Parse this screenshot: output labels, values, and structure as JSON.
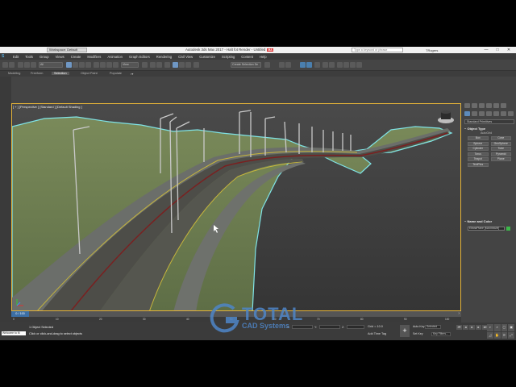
{
  "titlebar": {
    "workspace": "Workspace: Default",
    "title": "Autodesk 3ds Max 2017 - Halt fot Render - Untitled",
    "badge": "MA",
    "search_placeholder": "Type a keyword or phrase",
    "user": "TRogers",
    "win_min": "—",
    "win_max": "□",
    "win_close": "✕"
  },
  "menubar": {
    "logo": "S",
    "items": [
      "Edit",
      "Tools",
      "Group",
      "Views",
      "Create",
      "Modifiers",
      "Animation",
      "Graph Editors",
      "Rendering",
      "Civil View",
      "Customize",
      "Scripting",
      "Content",
      "Help"
    ]
  },
  "toolbar": {
    "selection_set": "Create Selection Se"
  },
  "ribbon": {
    "tabs": [
      "Modeling",
      "Freeform",
      "Selection",
      "Object Paint",
      "Populate"
    ]
  },
  "viewport": {
    "label": "[ + ] [Perspective ] [Standard ] [Default Shading ]"
  },
  "command_panel": {
    "dropdown": "Standard Primitives",
    "object_type_header": "Object Type",
    "autogrid": "AutoGrid",
    "primitives": [
      "Box",
      "Cone",
      "Sphere",
      "GeoSphere",
      "Cylinder",
      "Tube",
      "Torus",
      "Pyramid",
      "Teapot",
      "Plane",
      "TextPlus"
    ],
    "name_color_header": "Name and Color",
    "object_name": "ElbowPlane [MAXIMUM]",
    "swatch_color": "#3cb84a"
  },
  "timeline": {
    "slider": "0 / 100",
    "ticks": [
      "0",
      "10",
      "20",
      "30",
      "40",
      "50",
      "60",
      "70",
      "80",
      "90",
      "100"
    ]
  },
  "status": {
    "maxscript": "Welcome to M",
    "selected_count": "1 Object Selected",
    "prompt": "Click or click-and-drag to select objects",
    "x_label": "X:",
    "y_label": "Y:",
    "z_label": "Z:",
    "grid": "Grid = 10.0",
    "add_time_tag": "Add Time Tag",
    "auto_key": "Auto Key",
    "set_key": "Set Key",
    "selected_dd": "Selected",
    "key_filters": "Key Filters...",
    "key_icon": "+"
  },
  "watermark": {
    "line1": "TOTAL",
    "line2": "CAD Systems"
  },
  "colors": {
    "viewport_bg": "#3f3f3f",
    "terrain": "#6e7f52",
    "selection_outline": "#7fe3e6",
    "road": "#4d4d48",
    "median_red": "#7a2020",
    "lane_yellow": "#c7b63c",
    "viewport_border": "#e4b339"
  }
}
